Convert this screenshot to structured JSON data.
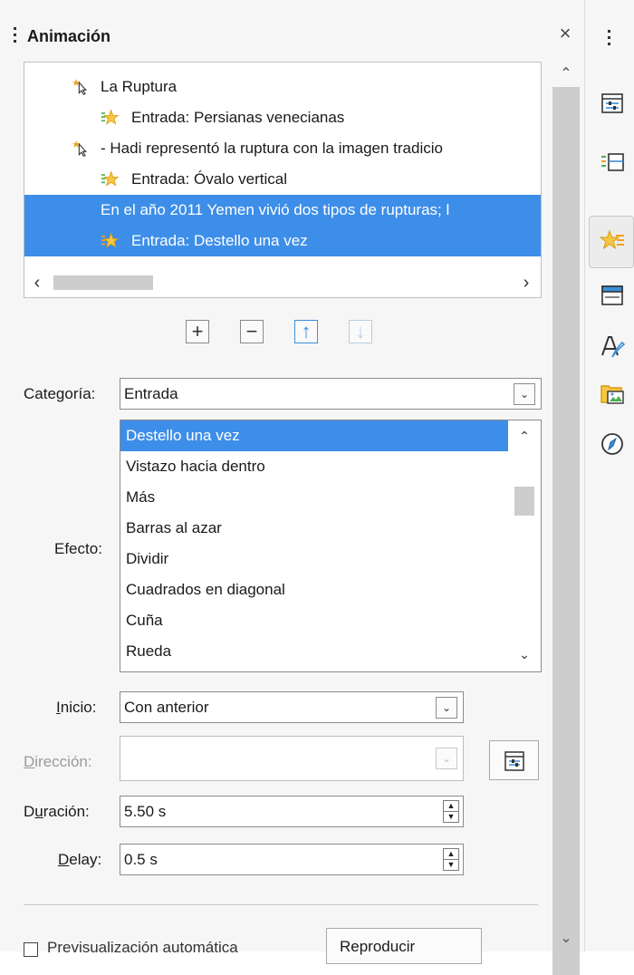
{
  "panel": {
    "title": "Animación",
    "close_label": "×"
  },
  "animation_tree": [
    {
      "text": "La Ruptura",
      "kind": "object",
      "selected": false
    },
    {
      "text": "Entrada: Persianas venecianas",
      "kind": "effect",
      "selected": false
    },
    {
      "text": "- Hadi representó la ruptura con la imagen tradicio",
      "kind": "object",
      "selected": false
    },
    {
      "text": "Entrada: Óvalo vertical",
      "kind": "effect",
      "selected": false
    },
    {
      "text": "En el año 2011 Yemen vivió dos tipos de rupturas; l",
      "kind": "object",
      "selected": true
    },
    {
      "text": "Entrada: Destello una vez",
      "kind": "effect",
      "selected": true
    }
  ],
  "toolbar": {
    "add": "+",
    "remove": "−",
    "move_up": "↑",
    "move_down": "↓"
  },
  "form": {
    "category_label": "Categoría:",
    "category_value": "Entrada",
    "effect_label": "Efecto:",
    "effects": [
      "Destello una vez",
      "Vistazo hacia dentro",
      "Más",
      "Barras al azar",
      "Dividir",
      "Cuadrados en diagonal",
      "Cuña",
      "Rueda"
    ],
    "selected_effect_index": 0,
    "start_label_pre": "",
    "start_label_mn": "I",
    "start_label_post": "nicio:",
    "start_value": "Con anterior",
    "direction_label_mn": "D",
    "direction_label_post": "irección:",
    "direction_value": "",
    "duration_label_pre": "D",
    "duration_label_mn": "u",
    "duration_label_post": "ración:",
    "duration_value": "5.50 s",
    "delay_label_mn": "D",
    "delay_label_post": "elay:",
    "delay_value": "0.5 s"
  },
  "bottom": {
    "autopreview_label": "Previsualización automática",
    "play_label": "Reproducir"
  },
  "colors": {
    "selection": "#3d8ee8",
    "panel_bg": "#f6f6f6",
    "accent_blue": "#3b8fd6",
    "star_orange": "#f0a21c",
    "star_green": "#4caf50"
  }
}
